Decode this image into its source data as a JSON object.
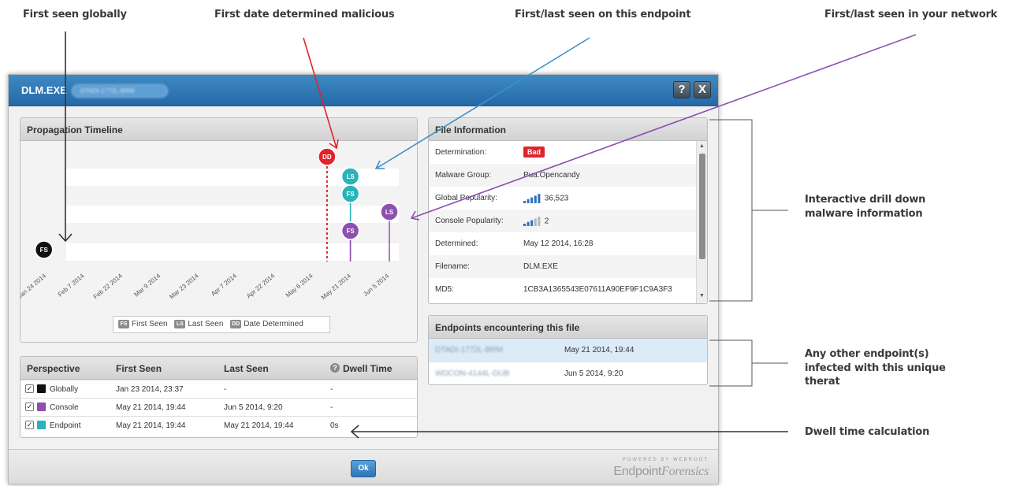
{
  "callouts": {
    "first_seen_globally": "First seen globally",
    "first_date_malicious": "First date determined malicious",
    "first_last_endpoint": "First/last seen on this endpoint",
    "first_last_network": "First/last seen in your network",
    "drill_down": "Interactive drill down malware information",
    "other_endpoints": "Any other endpoint(s) infected with this unique therat",
    "dwell_time": "Dwell time calculation"
  },
  "dialog": {
    "title": "DLM.EXE",
    "endpoint_pill": "DTADI-1772L-BRM",
    "help_label": "?",
    "close_label": "X",
    "ok_label": "Ok",
    "brand_small": "POWERED BY WEBROOT",
    "brand_name": "Endpoint",
    "brand_suffix": "Forensics"
  },
  "timeline": {
    "title": "Propagation Timeline",
    "markers": {
      "fs": "FS",
      "ls": "LS",
      "dd": "DD"
    },
    "legend": {
      "first_seen": "First Seen",
      "last_seen": "Last Seen",
      "date_determined": "Date Determined"
    },
    "colors": {
      "global": "#111111",
      "console": "#8e4fb0",
      "endpoint": "#2ab3b8",
      "determined": "#e0242b"
    }
  },
  "chart_data": {
    "type": "scatter",
    "x_ticks": [
      "Jan 24 2014",
      "Feb 7 2014",
      "Feb 22 2014",
      "Mar 9 2014",
      "Mar 23 2014",
      "Apr 7 2014",
      "Apr 22 2014",
      "May 6 2014",
      "May 21 2014",
      "Jun 5 2014"
    ],
    "events": [
      {
        "label": "FS",
        "perspective": "Globally",
        "date": "Jan 23 2014"
      },
      {
        "label": "DD",
        "perspective": "Determined",
        "date": "May 12 2014"
      },
      {
        "label": "FS",
        "perspective": "Console",
        "date": "May 21 2014"
      },
      {
        "label": "LS",
        "perspective": "Console",
        "date": "Jun 5 2014"
      },
      {
        "label": "FS",
        "perspective": "Endpoint",
        "date": "May 21 2014"
      },
      {
        "label": "LS",
        "perspective": "Endpoint",
        "date": "May 21 2014"
      }
    ]
  },
  "perspective": {
    "headers": {
      "perspective": "Perspective",
      "first_seen": "First Seen",
      "last_seen": "Last Seen",
      "dwell": "Dwell Time"
    },
    "rows": [
      {
        "name": "Globally",
        "first": "Jan 23 2014, 23:37",
        "last": "-",
        "dwell": "-",
        "color": "#111111",
        "checked": "✓"
      },
      {
        "name": "Console",
        "first": "May 21 2014, 19:44",
        "last": "Jun 5 2014, 9:20",
        "dwell": "-",
        "color": "#8e4fb0",
        "checked": "✓"
      },
      {
        "name": "Endpoint",
        "first": "May 21 2014, 19:44",
        "last": "May 21 2014, 19:44",
        "dwell": "0s",
        "color": "#2ab3b8",
        "checked": "✓"
      }
    ]
  },
  "file_info": {
    "title": "File Information",
    "rows": [
      {
        "label": "Determination:",
        "value": "Bad"
      },
      {
        "label": "Malware Group:",
        "value": "Pua.Opencandy"
      },
      {
        "label": "Global Popularity:",
        "value": "36,523"
      },
      {
        "label": "Console Popularity:",
        "value": "2"
      },
      {
        "label": "Determined:",
        "value": "May 12 2014, 16:28"
      },
      {
        "label": "Filename:",
        "value": "DLM.EXE"
      },
      {
        "label": "MD5:",
        "value": "1CB3A1365543E07611A90EF9F1C9A3F3"
      }
    ],
    "popularity": {
      "global_bars": 5,
      "console_bars": 2,
      "total_bars": 5
    }
  },
  "endpoints": {
    "title": "Endpoints encountering this file",
    "rows": [
      {
        "name": "DTADI-1772L-BRM",
        "date": "May 21 2014, 19:44"
      },
      {
        "name": "WDCON-4144L-DUB",
        "date": "Jun 5 2014, 9:20"
      }
    ]
  }
}
